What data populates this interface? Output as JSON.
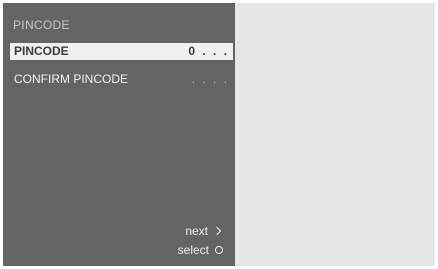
{
  "menu": {
    "title": "PINCODE",
    "rows": [
      {
        "label": "PINCODE",
        "value": "0 . . .",
        "selected": true
      },
      {
        "label": "CONFIRM PINCODE",
        "value": ". . . .",
        "selected": false
      }
    ]
  },
  "hints": {
    "next": {
      "label": "next",
      "icon": "chevron-right-icon"
    },
    "select": {
      "label": "select",
      "icon": "circle-icon"
    }
  }
}
